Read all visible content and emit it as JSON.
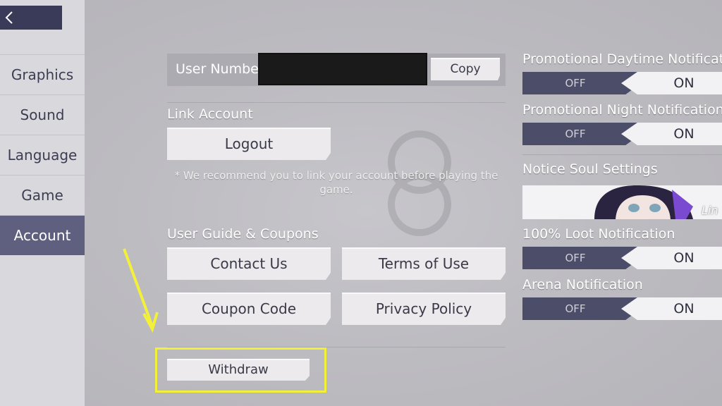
{
  "sidebar": {
    "items": [
      {
        "label": "Graphics"
      },
      {
        "label": "Sound"
      },
      {
        "label": "Language"
      },
      {
        "label": "Game"
      },
      {
        "label": "Account",
        "active": true
      }
    ]
  },
  "account": {
    "user_number_label": "User Number",
    "copy_label": "Copy",
    "link_account_title": "Link Account",
    "logout_label": "Logout",
    "note_line1": "* We recommend you to link your account before playing the",
    "note_line2": "game.",
    "guide_title": "User Guide & Coupons",
    "contact_label": "Contact Us",
    "terms_label": "Terms of Use",
    "coupon_label": "Coupon Code",
    "privacy_label": "Privacy Policy",
    "withdraw_label": "Withdraw"
  },
  "notifications": {
    "promo_day": {
      "label": "Promotional Daytime Notification",
      "off": "OFF",
      "on": "ON",
      "state": "ON"
    },
    "promo_night": {
      "label": "Promotional Night Notifications",
      "off": "OFF",
      "on": "ON",
      "state": "ON"
    },
    "soul_settings": {
      "label": "Notice Soul Settings",
      "soul_name": "Lin"
    },
    "loot": {
      "label": "100% Loot Notification",
      "off": "OFF",
      "on": "ON",
      "state": "ON"
    },
    "arena": {
      "label": "Arena Notification",
      "off": "OFF",
      "on": "ON",
      "state": "ON"
    }
  },
  "colors": {
    "sidebar_active": "#5f6080",
    "toggle_off": "#4c4d68",
    "highlight": "#f3f03a"
  }
}
